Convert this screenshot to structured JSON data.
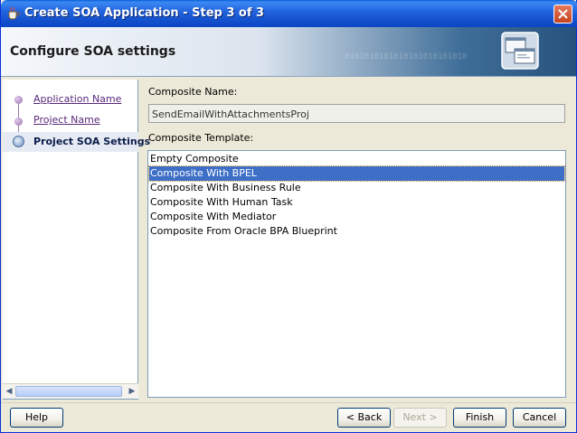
{
  "window": {
    "title": "Create SOA Application - Step 3 of 3",
    "icon": "coffee-cup-icon",
    "close_icon": "close-icon"
  },
  "banner": {
    "title": "Configure SOA settings",
    "decor_text": "0101010101010101010101010",
    "graphic_icon": "windows-graphic-icon"
  },
  "nav": {
    "items": [
      {
        "label": "Application Name"
      },
      {
        "label": "Project Name"
      },
      {
        "label": "Project SOA Settings"
      }
    ]
  },
  "form": {
    "composite_name_label": "Composite Name:",
    "composite_name_value": "SendEmailWithAttachmentsProj",
    "composite_template_label": "Composite Template:",
    "templates": [
      "Empty Composite",
      "Composite With BPEL",
      "Composite With Business Rule",
      "Composite With Human Task",
      "Composite With Mediator",
      "Composite From Oracle BPA Blueprint"
    ],
    "selected_template": "Composite With BPEL"
  },
  "buttons": {
    "help": "Help",
    "back": "< Back",
    "next": "Next >",
    "finish": "Finish",
    "cancel": "Cancel"
  },
  "colors": {
    "selection": "#3d6fc6",
    "titlebar": "#1553cf",
    "nav_visited": "#58297a"
  }
}
